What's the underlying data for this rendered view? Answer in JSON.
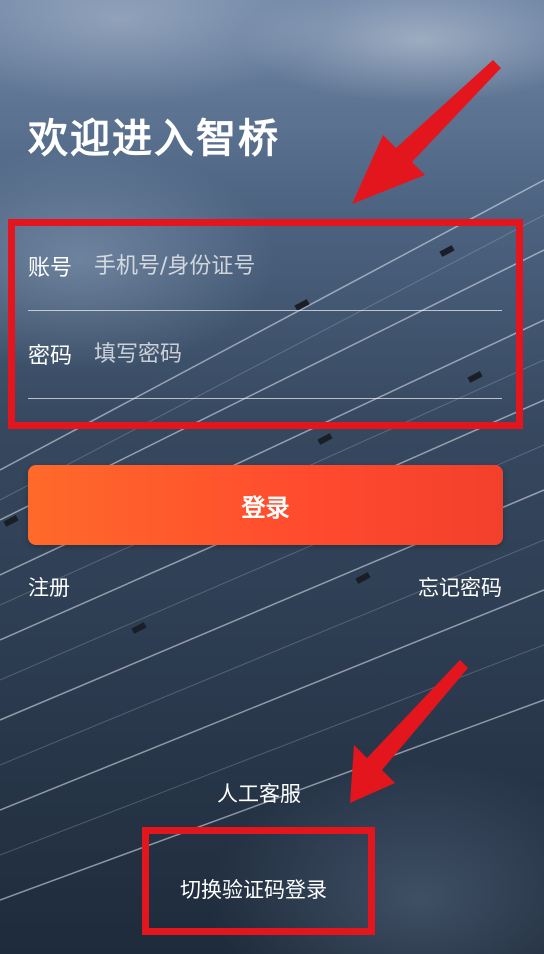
{
  "header": {
    "title": "欢迎进入智桥"
  },
  "form": {
    "account": {
      "label": "账号",
      "placeholder": "手机号/身份证号"
    },
    "password": {
      "label": "密码",
      "placeholder": "填写密码"
    }
  },
  "actions": {
    "login_label": "登录",
    "register_label": "注册",
    "forgot_label": "忘记密码"
  },
  "footer": {
    "support_label": "人工客服",
    "switch_label": "切换验证码登录"
  },
  "colors": {
    "accent": "#ff5a2c",
    "annotation": "#e3161e"
  }
}
